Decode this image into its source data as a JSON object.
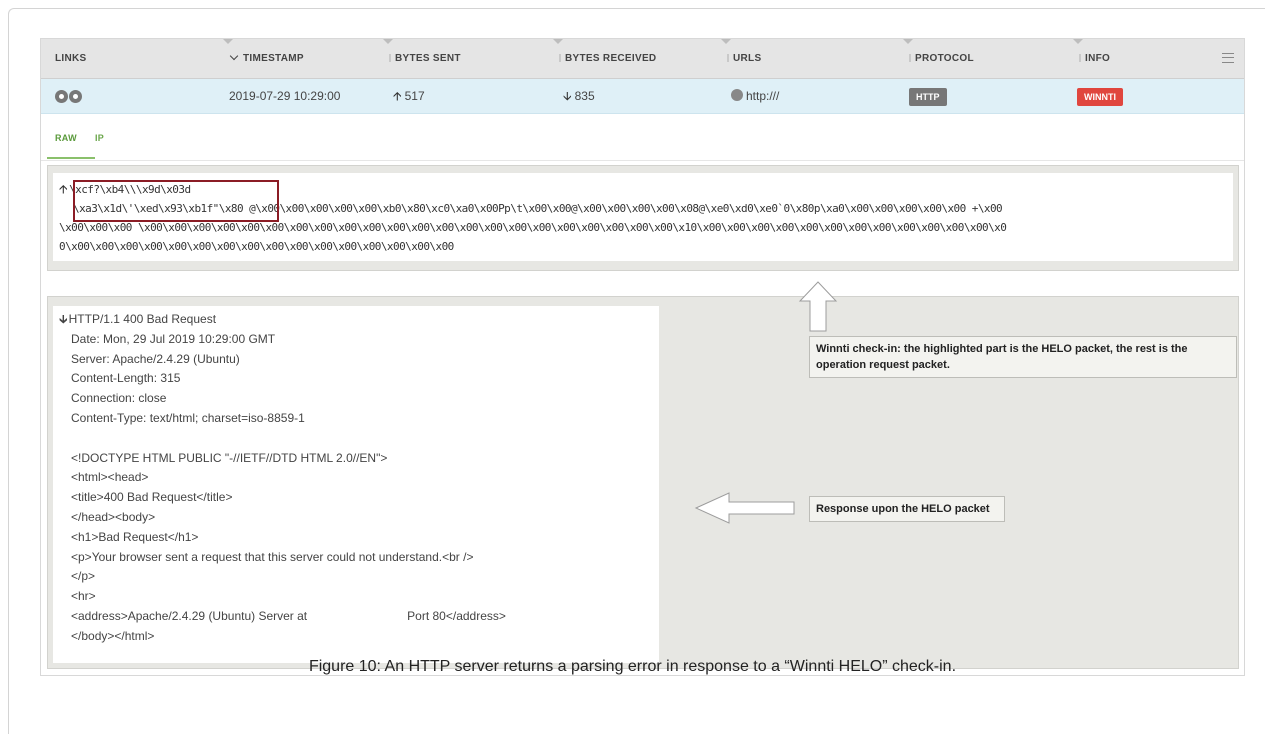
{
  "table": {
    "headers": {
      "links": "LINKS",
      "timestamp": "TIMESTAMP",
      "bytes_sent": "BYTES SENT",
      "bytes_received": "BYTES RECEIVED",
      "urls": "URLS",
      "protocol": "PROTOCOL",
      "info": "INFO"
    },
    "row": {
      "timestamp": "2019-07-29 10:29:00",
      "bytes_sent": "517",
      "bytes_received": "835",
      "url": "http:///",
      "protocol": "HTTP",
      "info": "WINNTI"
    }
  },
  "tabs": {
    "raw": "RAW",
    "ip": "IP"
  },
  "raw": {
    "line1": "\\xcf?\\xb4\\\\\\x9d\\x03d",
    "line2_highlight": "\\xa3\\x1d\\'\\xed\\x93\\xb1f\"\\x80",
    "line2_rest": " @\\x00\\x00\\x00\\x00\\x00\\xb0\\x80\\xc0\\xa0\\x00Pp\\t\\x00\\x00@\\x00\\x00\\x00\\x00\\x08@\\xe0\\xd0\\xe0`0\\x80p\\xa0\\x00\\x00\\x00\\x00\\x00 +\\x00",
    "line3": "\\x00\\x00\\x00 \\x00\\x00\\x00\\x00\\x00\\x00\\x00\\x00\\x00\\x00\\x00\\x00\\x00\\x00\\x00\\x00\\x00\\x00\\x00\\x00\\x00\\x00\\x10\\x00\\x00\\x00\\x00\\x00\\x00\\x00\\x00\\x00\\x00\\x00\\x00\\x0",
    "line4": "0\\x00\\x00\\x00\\x00\\x00\\x00\\x00\\x00\\x00\\x00\\x00\\x00\\x00\\x00\\x00\\x00"
  },
  "response": {
    "lines": [
      "HTTP/1.1 400 Bad Request",
      "Date: Mon, 29 Jul 2019 10:29:00 GMT",
      "Server: Apache/2.4.29 (Ubuntu)",
      "Content-Length: 315",
      "Connection: close",
      "Content-Type: text/html; charset=iso-8859-1",
      "",
      "<!DOCTYPE HTML PUBLIC \"-//IETF//DTD HTML 2.0//EN\">",
      "<html><head>",
      "<title>400 Bad Request</title>",
      "</head><body>",
      "<h1>Bad Request</h1>",
      "<p>Your browser sent a request that this server could not understand.<br />",
      "</p>",
      "<hr>",
      "<address>Apache/2.4.29 (Ubuntu) Server at                              Port 80</address>",
      "</body></html>"
    ]
  },
  "annotations": {
    "checkin_note": "Winnti check-in: the highlighted part is the HELO packet, the rest is the operation request packet.",
    "response_note": "Response upon the HELO packet"
  },
  "caption": "Figure 10: An HTTP server returns a parsing error in response to a “Winnti HELO” check-in.",
  "colors": {
    "row_highlight": "#dff0f7",
    "protocol_badge": "#777777",
    "info_badge": "#e0463e",
    "highlight_box": "#8b1c25",
    "tab_active": "#5a9a3b"
  }
}
